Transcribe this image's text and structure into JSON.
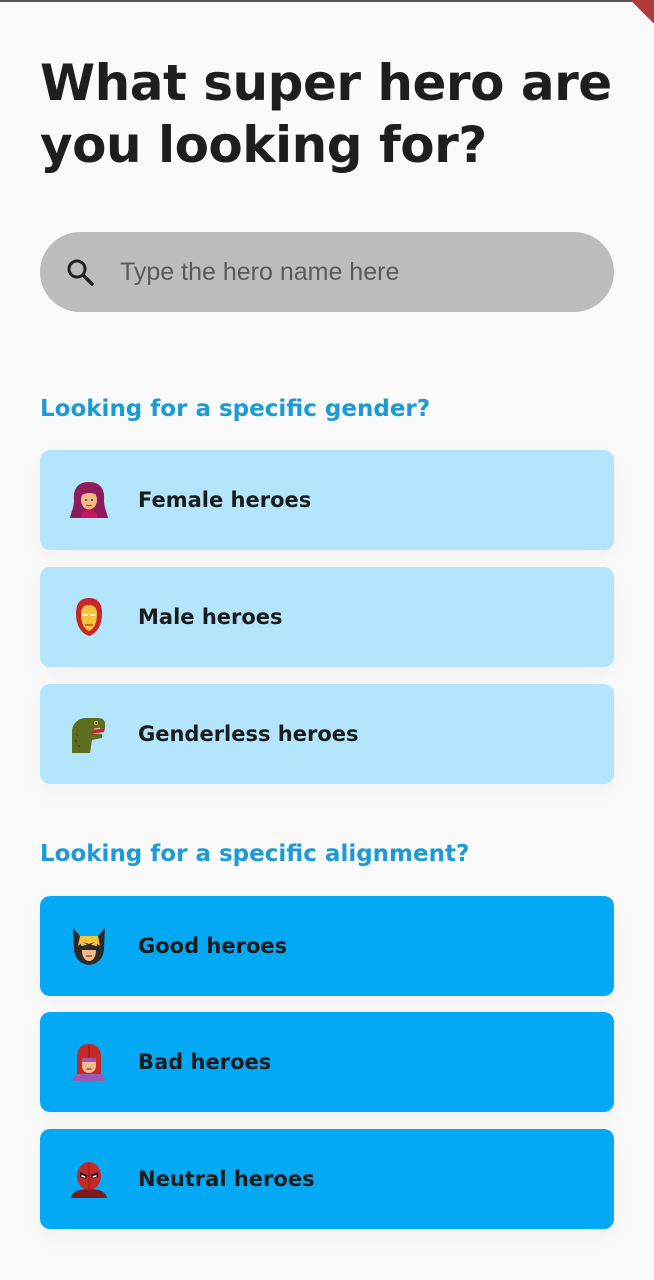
{
  "header": {
    "title": "What super hero are you looking for?"
  },
  "search": {
    "placeholder": "Type the hero name here",
    "value": "",
    "icon": "search-icon"
  },
  "gender_section": {
    "heading": "Looking for a specific gender?",
    "items": [
      {
        "label": "Female heroes",
        "icon": "female-hero-icon"
      },
      {
        "label": "Male heroes",
        "icon": "iron-man-icon"
      },
      {
        "label": "Genderless heroes",
        "icon": "dinosaur-icon"
      }
    ]
  },
  "alignment_section": {
    "heading": "Looking for a specific alignment?",
    "items": [
      {
        "label": "Good heroes",
        "icon": "wolverine-icon"
      },
      {
        "label": "Bad heroes",
        "icon": "magneto-icon"
      },
      {
        "label": "Neutral heroes",
        "icon": "deadpool-icon"
      }
    ]
  },
  "colors": {
    "accent": "#1a9ad6",
    "card_light": "#b3e5fc",
    "card_strong": "#03a9f4",
    "search_bg": "#bdbdbd",
    "background": "#fafafa"
  }
}
